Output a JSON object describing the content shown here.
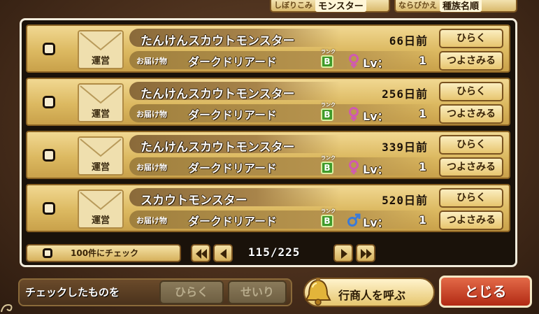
{
  "filters": {
    "narrow_label": "しぼりこみ",
    "narrow_value": "モンスター",
    "sort_label": "ならびかえ",
    "sort_value": "種族名順"
  },
  "mail_items": [
    {
      "sender": "運営",
      "title": "たんけんスカウトモンスター",
      "date": "66日前",
      "gift_label": "お届け物",
      "gift_name": "ダークドリアード",
      "rank": "B",
      "rank_tag": "ランク",
      "gender": "female",
      "lv_label": "Lv：",
      "lv": "1",
      "open_label": "ひらく",
      "strengthen_label": "つよさみる"
    },
    {
      "sender": "運営",
      "title": "たんけんスカウトモンスター",
      "date": "256日前",
      "gift_label": "お届け物",
      "gift_name": "ダークドリアード",
      "rank": "B",
      "rank_tag": "ランク",
      "gender": "female",
      "lv_label": "Lv：",
      "lv": "1",
      "open_label": "ひらく",
      "strengthen_label": "つよさみる"
    },
    {
      "sender": "運営",
      "title": "たんけんスカウトモンスター",
      "date": "339日前",
      "gift_label": "お届け物",
      "gift_name": "ダークドリアード",
      "rank": "B",
      "rank_tag": "ランク",
      "gender": "female",
      "lv_label": "Lv：",
      "lv": "1",
      "open_label": "ひらく",
      "strengthen_label": "つよさみる"
    },
    {
      "sender": "運営",
      "title": "スカウトモンスター",
      "date": "520日前",
      "gift_label": "お届け物",
      "gift_name": "ダークドリアード",
      "rank": "B",
      "rank_tag": "ランク",
      "gender": "male",
      "lv_label": "Lv：",
      "lv": "1",
      "open_label": "ひらく",
      "strengthen_label": "つよさみる"
    }
  ],
  "pager": {
    "check100_label": "100件にチェック",
    "current": "115",
    "total": "225",
    "indicator": "115/225"
  },
  "bottom": {
    "checked_label": "チェックしたものを",
    "open_label": "ひらく",
    "discard_label": "せいり",
    "merchant_label": "行商人を呼ぶ",
    "close_label": "とじる"
  },
  "colors": {
    "female": "#d05ab0",
    "male": "#3a7ad8",
    "rank_b": "#3f9a2a",
    "close": "#c83a1e"
  }
}
